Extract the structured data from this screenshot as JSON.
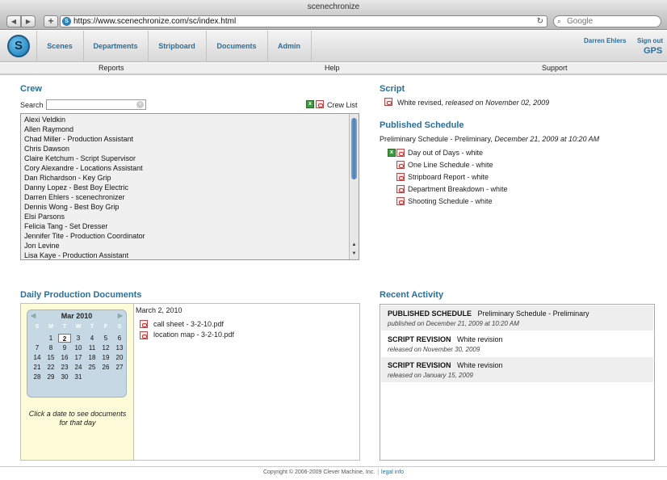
{
  "browser": {
    "window_title": "scenechronize",
    "url": "https://www.scenechronize.com/sc/index.html",
    "search_placeholder": "Google",
    "back_glyph": "◀",
    "forward_glyph": "▶",
    "add_glyph": "+",
    "reload_glyph": "↻",
    "search_glyph": "⌕"
  },
  "app": {
    "logo_letter": "S",
    "nav_tabs": [
      "Scenes",
      "Departments",
      "Stripboard",
      "Documents",
      "Admin"
    ],
    "user_name": "Darren Ehlers",
    "sign_out": "Sign out",
    "project_code": "GPS",
    "sub_nav": [
      "Reports",
      "Help",
      "Support"
    ]
  },
  "crew": {
    "title": "Crew",
    "search_label": "Search",
    "search_value": "",
    "crew_list_link": "Crew List",
    "members": [
      "Alexi Veldkin",
      "Allen Raymond",
      "Chad Miller - Production Assistant",
      "Chris Dawson",
      "Claire Ketchum - Script Supervisor",
      "Cory Alexandre - Locations Assistant",
      "Dan Richardson - Key Grip",
      "Danny Lopez - Best Boy Electric",
      "Darren Ehlers - scenechronizer",
      "Dennis Wong - Best Boy Grip",
      "Elsi Parsons",
      "Felicia Tang - Set Dresser",
      "Jennifer Tite - Production Coordinator",
      "Jon Levine",
      "Lisa Kaye - Production Assistant"
    ]
  },
  "script": {
    "title": "Script",
    "doc_name": "White revised, ",
    "doc_release": "released on November 02, 2009"
  },
  "published_schedule": {
    "title": "Published Schedule",
    "schedule_name": "Preliminary Schedule - Preliminary, ",
    "schedule_date": "December 21, 2009 at 10:20 AM",
    "reports": [
      "Day out of Days - white",
      "One Line Schedule - white",
      "Stripboard Report - white",
      "Department Breakdown - white",
      "Shooting Schedule - white"
    ]
  },
  "daily_docs": {
    "title": "Daily Production Documents",
    "calendar_month": "Mar 2010",
    "prev_glyph": "◀",
    "next_glyph": "▶",
    "weekdays": [
      "S",
      "M",
      "T",
      "W",
      "T",
      "F",
      "S"
    ],
    "weeks": [
      [
        "",
        "1",
        "2",
        "3",
        "4",
        "5",
        "6"
      ],
      [
        "7",
        "8",
        "9",
        "10",
        "11",
        "12",
        "13"
      ],
      [
        "14",
        "15",
        "16",
        "17",
        "18",
        "19",
        "20"
      ],
      [
        "21",
        "22",
        "23",
        "24",
        "25",
        "26",
        "27"
      ],
      [
        "28",
        "29",
        "30",
        "31",
        "",
        "",
        ""
      ]
    ],
    "selected_day": "2",
    "hint": "Click a date to see documents for that day",
    "selected_date_label": "March 2, 2010",
    "files": [
      "call sheet - 3-2-10.pdf",
      "location map - 3-2-10.pdf"
    ]
  },
  "recent_activity": {
    "title": "Recent Activity",
    "items": [
      {
        "kind": "PUBLISHED SCHEDULE",
        "name": "Preliminary Schedule - Preliminary",
        "detail": "published on December 21, 2009 at 10:20 AM"
      },
      {
        "kind": "SCRIPT REVISION",
        "name": "White revision",
        "detail": "released on November 30, 2009"
      },
      {
        "kind": "SCRIPT REVISION",
        "name": "White revision",
        "detail": "released on January 15, 2009"
      }
    ]
  },
  "footer": {
    "copyright": "Copyright © 2006-2009 Clever Machine, Inc.",
    "separator": "|",
    "legal_link": "legal info"
  }
}
